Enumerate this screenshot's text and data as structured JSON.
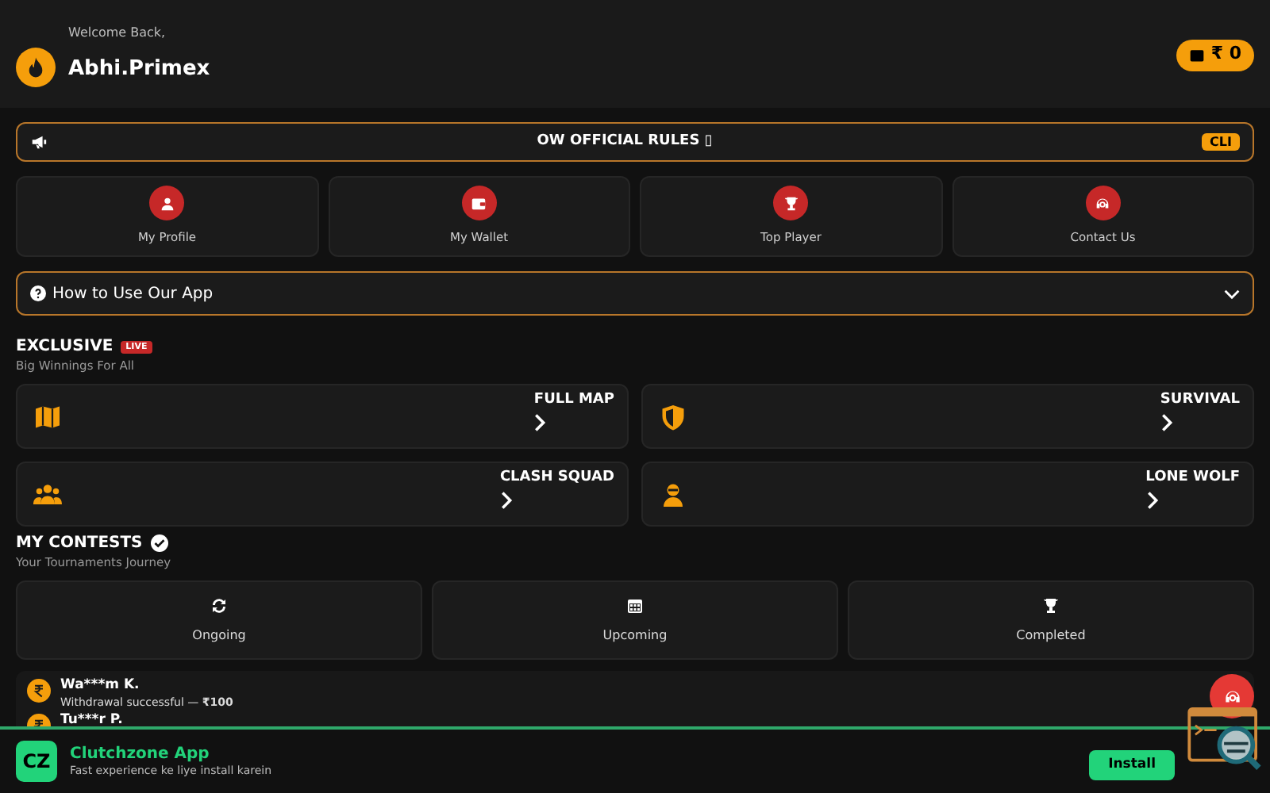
{
  "header": {
    "greeting": "Welcome Back,",
    "username": "Abhi.Primex",
    "balance": "₹ 0"
  },
  "rules_bar": {
    "text": "OW OFFICIAL RULES ▯",
    "badge": "CLI"
  },
  "quick_links": [
    {
      "label": "My Profile"
    },
    {
      "label": "My Wallet"
    },
    {
      "label": "Top Player"
    },
    {
      "label": "Contact Us"
    }
  ],
  "how_to": {
    "text": "How to Use Our App",
    "expanded": false
  },
  "exclusive": {
    "title": "EXCLUSIVE",
    "badge": "LIVE",
    "subtitle": "Big Winnings For All",
    "modes": [
      {
        "label": "FULL MAP"
      },
      {
        "label": "SURVIVAL"
      },
      {
        "label": "CLASH SQUAD"
      },
      {
        "label": "LONE WOLF"
      }
    ]
  },
  "contests": {
    "title": "MY CONTESTS",
    "subtitle": "Your Tournaments Journey",
    "tabs": [
      {
        "label": "Ongoing"
      },
      {
        "label": "Upcoming"
      },
      {
        "label": "Completed"
      }
    ]
  },
  "ticker": [
    {
      "name": "Wa***m K.",
      "message": "Withdrawal successful — **₹100**"
    },
    {
      "name": "Tu***r P."
    }
  ],
  "install_banner": {
    "logo": "CZ",
    "title": "Clutchzone App",
    "subtitle": "Fast experience ke liye install karein",
    "button": "Install"
  }
}
